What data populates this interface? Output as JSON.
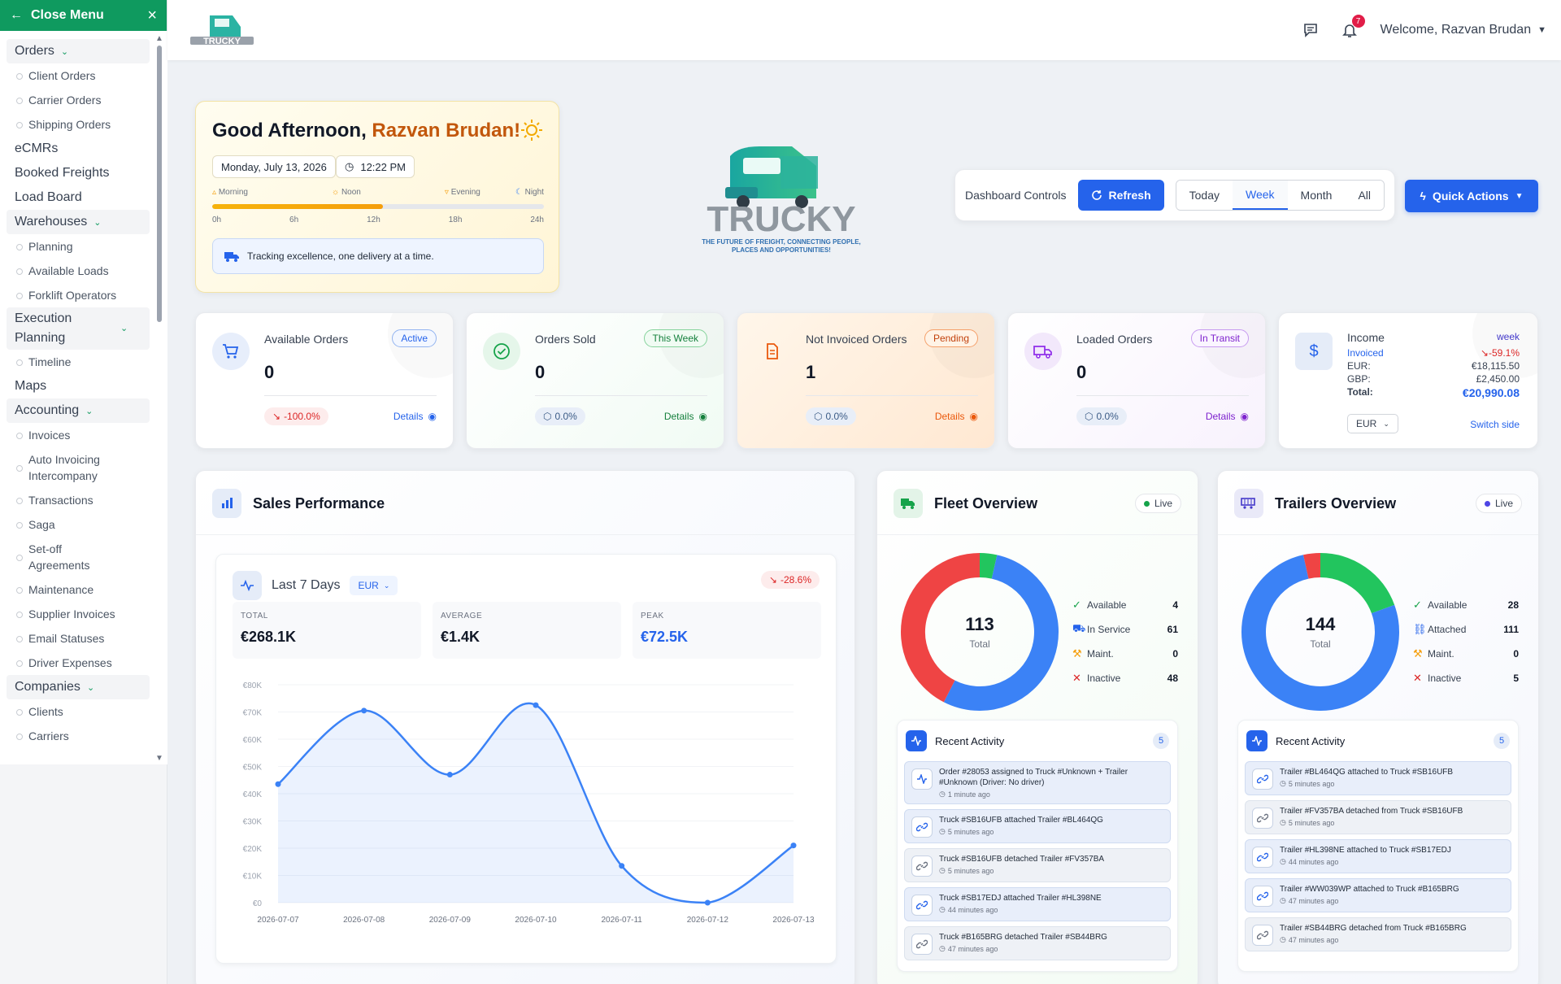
{
  "sidebar": {
    "close_label": "Close Menu",
    "orders": "Orders",
    "client_orders": "Client Orders",
    "carrier_orders": "Carrier Orders",
    "shipping_orders": "Shipping Orders",
    "ecmrs": "eCMRs",
    "booked_freights": "Booked Freights",
    "load_board": "Load Board",
    "warehouses": "Warehouses",
    "planning": "Planning",
    "available_loads": "Available Loads",
    "forklift_operators": "Forklift Operators",
    "execution_planning": "Execution Planning",
    "timeline": "Timeline",
    "maps": "Maps",
    "accounting": "Accounting",
    "invoices": "Invoices",
    "auto_invoicing": "Auto Invoicing Intercompany",
    "transactions": "Transactions",
    "saga": "Saga",
    "setoff": "Set-off Agreements",
    "maintenance": "Maintenance",
    "supplier_invoices": "Supplier Invoices",
    "email_statuses": "Email Statuses",
    "driver_expenses": "Driver Expenses",
    "companies": "Companies",
    "clients": "Clients",
    "carriers_partial": "Carriers"
  },
  "header": {
    "welcome": "Welcome, Razvan Brudan",
    "notif_count": "7"
  },
  "greeting": {
    "prefix": "Good Afternoon, ",
    "name": "Razvan Brudan!",
    "date": "Monday, July 13, 2026",
    "time": "12:22 PM",
    "periods": [
      "Morning",
      "Noon",
      "Evening",
      "Night"
    ],
    "hours": [
      "0h",
      "6h",
      "12h",
      "18h",
      "24h"
    ],
    "day_progress": 0.515,
    "tagline": "Tracking excellence, one delivery at a time."
  },
  "logo": {
    "word": "TRUCKY",
    "slogan1": "THE FUTURE OF FREIGHT, CONNECTING PEOPLE,",
    "slogan2": "PLACES AND OPPORTUNITIES!"
  },
  "controls": {
    "label": "Dashboard Controls",
    "refresh": "Refresh",
    "ranges": [
      "Today",
      "Week",
      "Month",
      "All"
    ],
    "active_range": "Week",
    "quick_actions": "Quick Actions"
  },
  "stats": [
    {
      "title": "Available Orders",
      "badge": "Active",
      "value": "0",
      "change": "-100.0%",
      "details": "Details",
      "color": "#2563eb"
    },
    {
      "title": "Orders Sold",
      "badge": "This Week",
      "value": "0",
      "change": "0.0%",
      "details": "Details",
      "color": "#16a34a"
    },
    {
      "title": "Not Invoiced Orders",
      "badge": "Pending",
      "value": "1",
      "change": "0.0%",
      "details": "Details",
      "color": "#ea580c"
    },
    {
      "title": "Loaded Orders",
      "badge": "In Transit",
      "value": "0",
      "change": "0.0%",
      "details": "Details",
      "color": "#9333ea"
    }
  ],
  "income": {
    "title": "Income",
    "period": "week",
    "invoiced": "Invoiced",
    "change": "-59.1%",
    "eur_label": "EUR:",
    "eur_value": "€18,115.50",
    "gbp_label": "GBP:",
    "gbp_value": "£2,450.00",
    "total_label": "Total:",
    "total_value": "€20,990.08",
    "currency": "EUR",
    "switch": "Switch side"
  },
  "sales": {
    "title": "Sales Performance",
    "subtitle": "Last 7 Days",
    "currency": "EUR",
    "change": "-28.6%",
    "total_label": "TOTAL",
    "total": "€268.1K",
    "average_label": "AVERAGE",
    "average": "€1.4K",
    "peak_label": "PEAK",
    "peak": "€72.5K"
  },
  "chart_data": {
    "type": "area",
    "x": [
      "2026-07-07",
      "2026-07-08",
      "2026-07-09",
      "2026-07-10",
      "2026-07-11",
      "2026-07-12",
      "2026-07-13"
    ],
    "y": [
      43500,
      70500,
      47000,
      72500,
      13500,
      0,
      21000
    ],
    "yticks": [
      "€0",
      "€10K",
      "€20K",
      "€30K",
      "€40K",
      "€50K",
      "€60K",
      "€70K",
      "€80K"
    ],
    "ylim": [
      0,
      80000
    ],
    "color": "#3b82f6"
  },
  "fleet": {
    "title": "Fleet Overview",
    "live": "Live",
    "total": "113",
    "total_label": "Total",
    "legend": [
      {
        "label": "Available",
        "value": 4,
        "color": "#22c55e"
      },
      {
        "label": "In Service",
        "value": 61,
        "color": "#3b82f6"
      },
      {
        "label": "Maint.",
        "value": 0,
        "color": "#f59e0b"
      },
      {
        "label": "Inactive",
        "value": 48,
        "color": "#ef4444"
      }
    ],
    "activity_title": "Recent Activity",
    "activity_count": "5",
    "activity": [
      {
        "text": "Order #28053 assigned to Truck #Unknown + Trailer #Unknown (Driver: No driver)",
        "time": "1 minute ago",
        "kind": "activity"
      },
      {
        "text": "Truck #SB16UFB attached Trailer #BL464QG",
        "time": "5 minutes ago",
        "kind": "link"
      },
      {
        "text": "Truck #SB16UFB detached Trailer #FV357BA",
        "time": "5 minutes ago",
        "kind": "unlink"
      },
      {
        "text": "Truck #SB17EDJ attached Trailer #HL398NE",
        "time": "44 minutes ago",
        "kind": "link"
      },
      {
        "text": "Truck #B165BRG detached Trailer #SB44BRG",
        "time": "47 minutes ago",
        "kind": "unlink"
      }
    ]
  },
  "trailers": {
    "title": "Trailers Overview",
    "live": "Live",
    "total": "144",
    "total_label": "Total",
    "legend": [
      {
        "label": "Available",
        "value": 28,
        "color": "#22c55e"
      },
      {
        "label": "Attached",
        "value": 111,
        "color": "#3b82f6"
      },
      {
        "label": "Maint.",
        "value": 0,
        "color": "#f59e0b"
      },
      {
        "label": "Inactive",
        "value": 5,
        "color": "#ef4444"
      }
    ],
    "activity_title": "Recent Activity",
    "activity_count": "5",
    "activity": [
      {
        "text": "Trailer #BL464QG attached to Truck #SB16UFB",
        "time": "5 minutes ago",
        "kind": "link"
      },
      {
        "text": "Trailer #FV357BA detached from Truck #SB16UFB",
        "time": "5 minutes ago",
        "kind": "unlink"
      },
      {
        "text": "Trailer #HL398NE attached to Truck #SB17EDJ",
        "time": "44 minutes ago",
        "kind": "link"
      },
      {
        "text": "Trailer #WW039WP attached to Truck #B165BRG",
        "time": "47 minutes ago",
        "kind": "link"
      },
      {
        "text": "Trailer #SB44BRG detached from Truck #B165BRG",
        "time": "47 minutes ago",
        "kind": "unlink"
      }
    ]
  }
}
